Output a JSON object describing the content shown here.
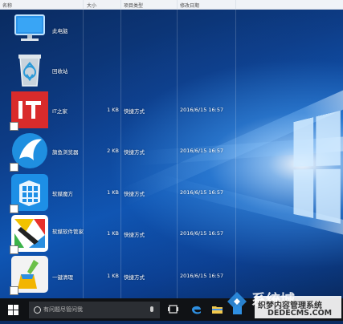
{
  "columns": {
    "name": "名称",
    "size": "大小",
    "type": "项目类型",
    "date": "修改日期"
  },
  "items": [
    {
      "name": "此电脑",
      "size": "",
      "type": "",
      "date": "",
      "icon": "computer-icon"
    },
    {
      "name": "回收站",
      "size": "",
      "type": "",
      "date": "",
      "icon": "recycle-bin-icon"
    },
    {
      "name": "IT之家",
      "size": "1 KB",
      "type": "快捷方式",
      "date": "2016/6/15 16:57",
      "icon": "ithome-icon"
    },
    {
      "name": "旗鱼浏览器",
      "size": "2 KB",
      "type": "快捷方式",
      "date": "2016/6/15 16:57",
      "icon": "sailfish-browser-icon"
    },
    {
      "name": "软媒魔方",
      "size": "1 KB",
      "type": "快捷方式",
      "date": "2016/6/15 16:57",
      "icon": "ruanmei-mofang-icon"
    },
    {
      "name": "软媒软件管家",
      "size": "1 KB",
      "type": "快捷方式",
      "date": "2016/6/15 16:57",
      "icon": "software-manager-icon"
    },
    {
      "name": "一键清理",
      "size": "1 KB",
      "type": "快捷方式",
      "date": "2016/6/15 16:57",
      "icon": "cleanup-icon"
    }
  ],
  "taskbar": {
    "search_placeholder": "有问题尽管问我",
    "icons": [
      "windows-start-icon",
      "cortana-icon",
      "microphone-icon",
      "task-view-icon",
      "edge-icon",
      "file-explorer-icon",
      "store-icon"
    ]
  },
  "watermark": {
    "logo_text": "系统城",
    "line1": "织梦内容管理系统",
    "line2": "DEDECMS.COM"
  }
}
